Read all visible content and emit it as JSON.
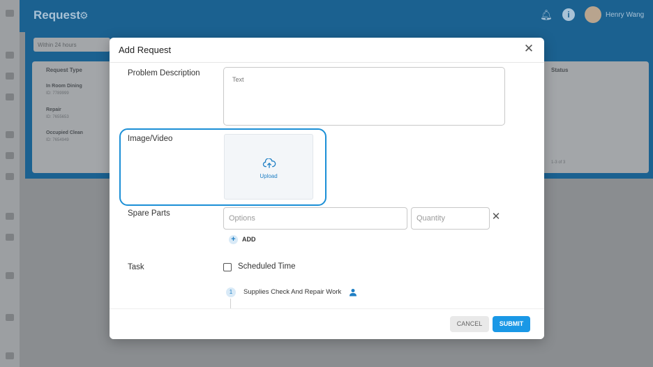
{
  "app": {
    "title": "Request",
    "user_name": "Henry Wang",
    "filters": [
      "Within 24 hours",
      "",
      ""
    ],
    "table": {
      "headers": [
        "Request Type",
        "Status"
      ],
      "rows": [
        {
          "type": "In Room Dining",
          "id": "ID: 7789999"
        },
        {
          "type": "Repair",
          "id": "ID: 7655653"
        },
        {
          "type": "Occupied Clean",
          "id": "ID: 7654949"
        }
      ],
      "pagination": "1-3 of 3"
    }
  },
  "modal": {
    "title": "Add Request",
    "fields": {
      "problem_description": {
        "label": "Problem Description",
        "placeholder": "Text"
      },
      "image_video": {
        "label": "Image/Video",
        "upload_label": "Upload"
      },
      "spare_parts": {
        "label": "Spare Parts",
        "options_placeholder": "Options",
        "quantity_placeholder": "Quantity",
        "add_label": "ADD"
      },
      "task": {
        "label": "Task",
        "checkbox_label": "Scheduled Time",
        "steps": [
          {
            "number": "1",
            "label": "Supplies Check And Repair Work"
          }
        ]
      }
    },
    "footer": {
      "cancel_label": "CANCEL",
      "submit_label": "SUBMIT"
    }
  },
  "colors": {
    "accent": "#1a98e6",
    "highlight_border": "#1b8fd6",
    "topbar": "#1b6190"
  }
}
